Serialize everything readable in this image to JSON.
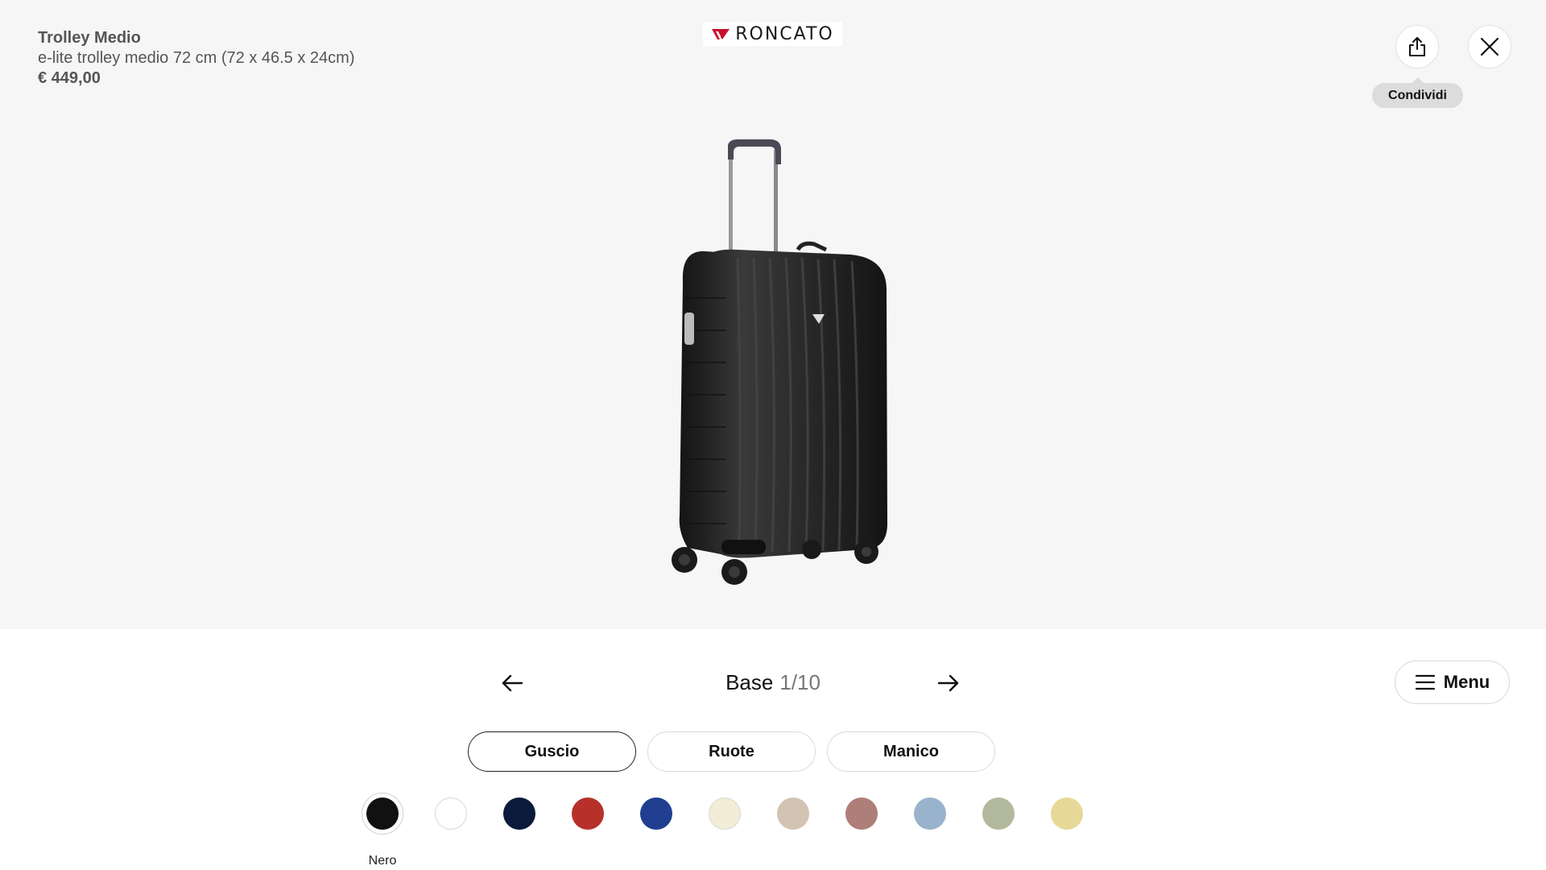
{
  "product": {
    "name": "Trolley Medio",
    "description": "e-lite trolley medio 72 cm (72 x 46.5 x 24cm)",
    "price": "€ 449,00"
  },
  "brand": {
    "name": "RONCATO",
    "accent": "#c8102e"
  },
  "header": {
    "share_tooltip": "Condividi"
  },
  "step": {
    "name": "Base",
    "counter": "1/10"
  },
  "menu": {
    "label": "Menu"
  },
  "tabs": [
    {
      "label": "Guscio",
      "active": true
    },
    {
      "label": "Ruote",
      "active": false
    },
    {
      "label": "Manico",
      "active": false
    }
  ],
  "colors": [
    {
      "hex": "#111111",
      "selected": true,
      "label": "Nero"
    },
    {
      "hex": "#ffffff"
    },
    {
      "hex": "#0b1a3a"
    },
    {
      "hex": "#b8302a"
    },
    {
      "hex": "#213f91"
    },
    {
      "hex": "#f3ecd6"
    },
    {
      "hex": "#d3c3b2"
    },
    {
      "hex": "#ad7f78"
    },
    {
      "hex": "#9ab3cc"
    },
    {
      "hex": "#b3b99c"
    },
    {
      "hex": "#e6d998"
    }
  ]
}
